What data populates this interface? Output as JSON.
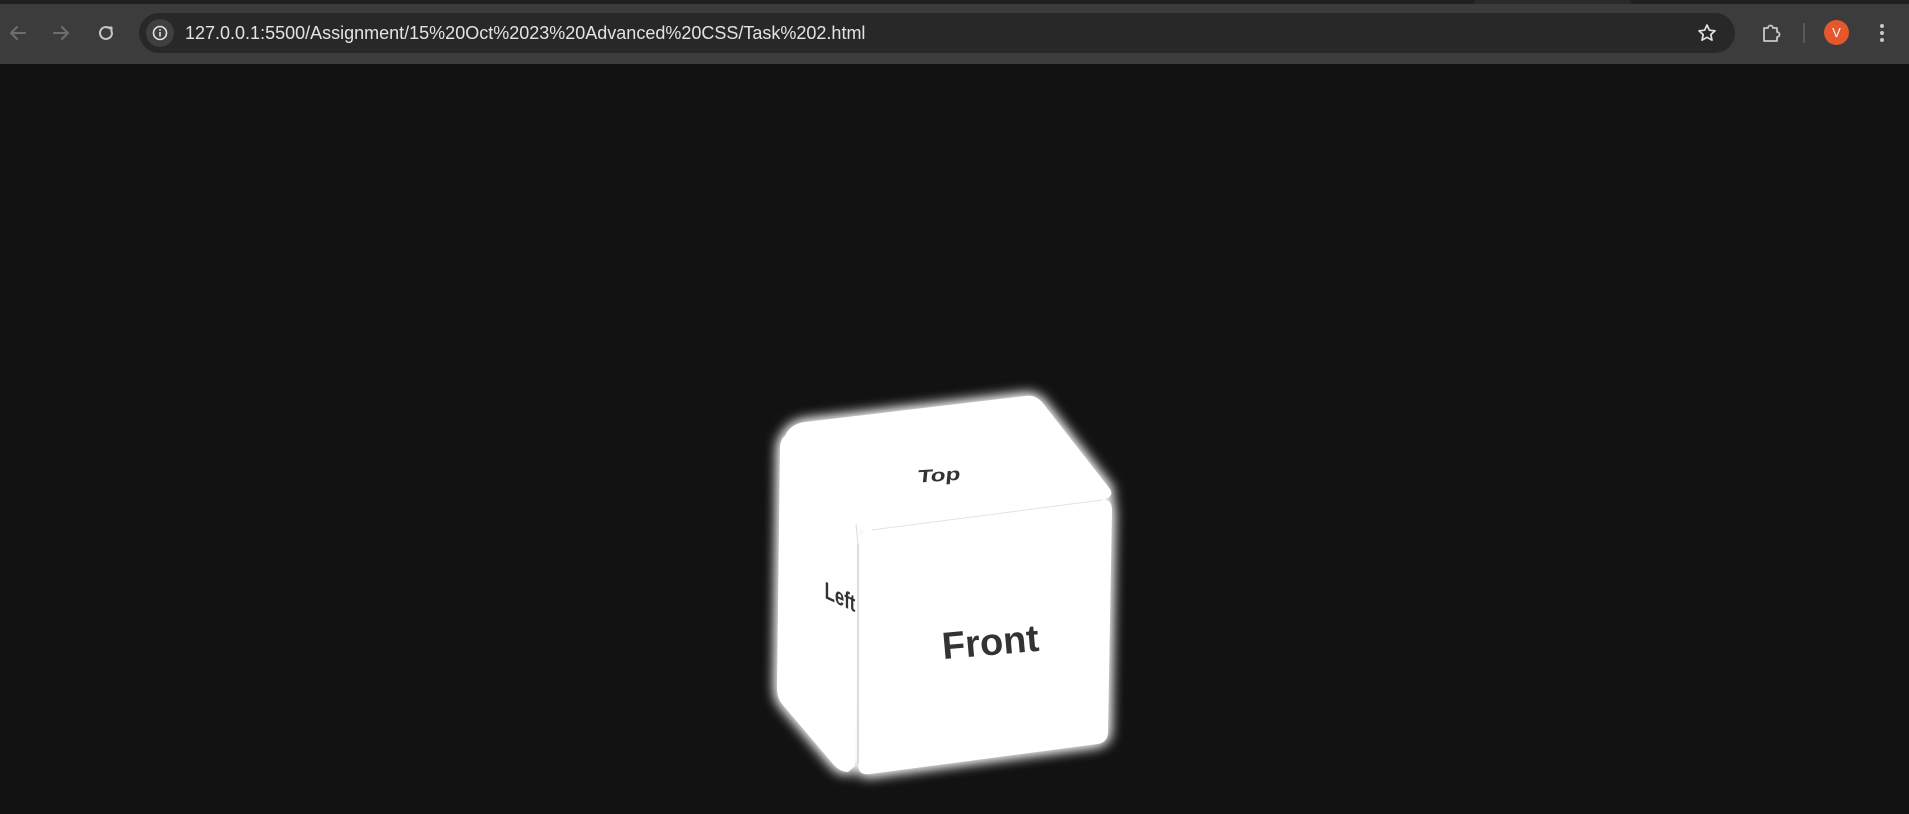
{
  "browser": {
    "url": "127.0.0.1:5500/Assignment/15%20Oct%2023%20Advanced%20CSS/Task%202.html",
    "profile_initial": "V",
    "icons": {
      "back": "arrow-left-icon",
      "forward": "arrow-right-icon",
      "reload": "reload-icon",
      "site_info": "info-icon",
      "bookmark": "star-icon",
      "extensions": "puzzle-icon",
      "menu": "kebab-menu-icon"
    },
    "colors": {
      "toolbar": "#3c3c3c",
      "omnibox": "#282828",
      "avatar": "#e8562c"
    }
  },
  "page": {
    "background": "#121212",
    "cube": {
      "face_color": "#ffffff",
      "glow_color": "#ffffff",
      "labels": {
        "top": "Top",
        "front": "Front",
        "left": "Left"
      }
    }
  }
}
